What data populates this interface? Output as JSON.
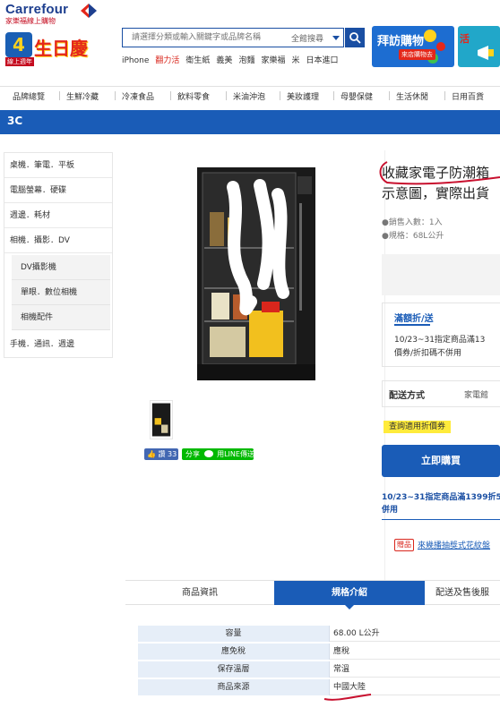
{
  "header": {
    "logo_text": "Carrefour",
    "logo_subtitle": "家樂福線上購物",
    "birthday_badge_number": "4",
    "birthday_badge_suffix": "th",
    "birthday_badge_text": "生日慶",
    "birthday_badge_sub": "線上週年",
    "search": {
      "placeholder": "請選擇分類或輸入關鍵字或品牌名稱",
      "scope": "全館搜尋"
    },
    "hot_words": [
      "iPhone",
      "翻力活",
      "衛生紙",
      "義美",
      "泡麵",
      "家樂福",
      "米",
      "日本進口"
    ],
    "banner1_title": "拜訪購物",
    "banner1_sub": "來店購物去",
    "banner2_title": "活"
  },
  "nav": [
    "品牌總覽",
    "生鮮冷藏",
    "冷凍食品",
    "飲料零食",
    "米油沖泡",
    "美妝護理",
    "母嬰保健",
    "生活休閒",
    "日用百貨"
  ],
  "category_bar": "3C",
  "sidebar": {
    "items": [
      "桌機．筆電．平板",
      "電腦螢幕．硬碟",
      "週邊．耗材",
      "相機．攝影．DV"
    ],
    "subitems": [
      "DV攝影機",
      "單眼．數位相機",
      "相機配件"
    ],
    "last_item": "手機．通訊．週邊"
  },
  "product": {
    "title_line1": "收藏家電子防潮箱",
    "title_line2": "示意圖，實際出貨",
    "sold_label": "●銷售入數：1入",
    "spec_label": "●規格：68L公升",
    "like_label": "讚 33",
    "share_label": "分享",
    "line_label": "用LINE傳送",
    "promo_heading": "滿額折/送",
    "promo_line1": "10/23~31指定商品滿13",
    "promo_line2": "價券/折扣碼不併用",
    "shipping_label": "配送方式",
    "shipping_value": "家電館",
    "coupon_button": "查詢適用折價券",
    "buy_button": "立即購買",
    "promo2_line1": "10/23~31指定商品滿1399折5",
    "promo2_line2": "併用",
    "gift_tag": "贈品",
    "gift_text": "來幾播抽獎式花紋盤"
  },
  "tabs": [
    "商品資訊",
    "規格介紹",
    "配送及售後服"
  ],
  "active_tab": "規格介紹",
  "spec": [
    {
      "key": "容量",
      "value": "68.00 L公升"
    },
    {
      "key": "應免稅",
      "value": "應稅"
    },
    {
      "key": "保存溫層",
      "value": "常溫"
    },
    {
      "key": "商品來源",
      "value": "中國大陸"
    }
  ],
  "colors": {
    "brand_blue": "#1a5cb7",
    "brand_red": "#d9261c",
    "coupon_yellow": "#ffeb3b"
  }
}
